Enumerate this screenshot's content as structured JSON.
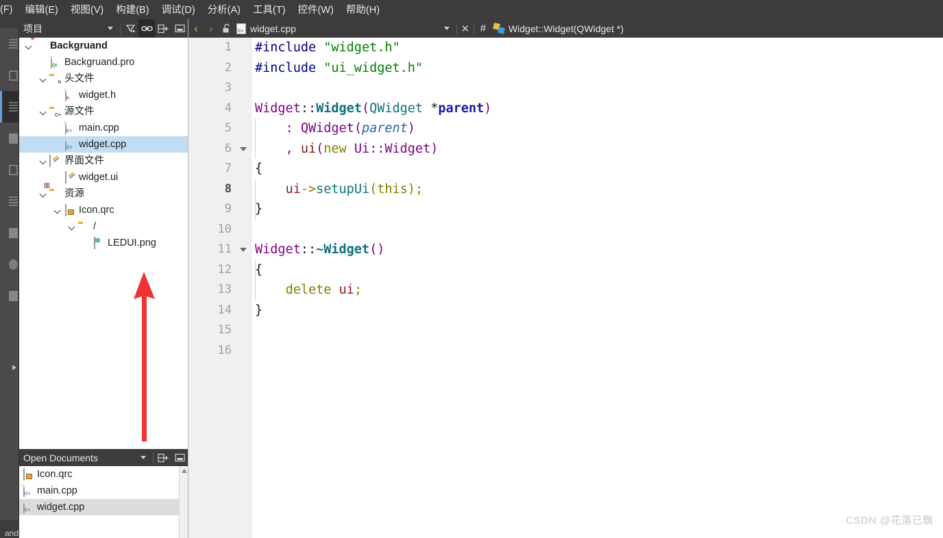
{
  "menubar": {
    "items": [
      {
        "label": "(F)",
        "mnemonic": ""
      },
      {
        "label": "编辑(E)",
        "mnemonic": "E"
      },
      {
        "label": "视图(V)",
        "mnemonic": "V"
      },
      {
        "label": "构建(B)",
        "mnemonic": "B"
      },
      {
        "label": "调试(D)",
        "mnemonic": "D"
      },
      {
        "label": "分析(A)",
        "mnemonic": "A"
      },
      {
        "label": "工具(T)",
        "mnemonic": "T"
      },
      {
        "label": "控件(W)",
        "mnemonic": "W"
      },
      {
        "label": "帮助(H)",
        "mnemonic": "H"
      }
    ]
  },
  "modebar": {
    "bottom_label": "and"
  },
  "dock": {
    "title": "项目",
    "tools": {
      "dropdown": "▾",
      "filter_icon": "filter-icon",
      "link_icon": "link-icon",
      "split_icon": "split-add-icon",
      "collapse_icon": "collapse-icon"
    }
  },
  "tree": {
    "items": [
      {
        "indent": 0,
        "chevron": "expanded",
        "icon": "project-gear-icon",
        "label": "Backgruand",
        "bold": true,
        "selected": false
      },
      {
        "indent": 1,
        "chevron": "none",
        "icon": "qt-pro-file-icon",
        "label": "Backgruand.pro",
        "bold": false,
        "selected": false
      },
      {
        "indent": 1,
        "chevron": "expanded",
        "icon": "folder-headers-icon",
        "label": "头文件",
        "bold": false,
        "selected": false
      },
      {
        "indent": 2,
        "chevron": "none",
        "icon": "header-file-icon",
        "label": "widget.h",
        "bold": false,
        "selected": false
      },
      {
        "indent": 1,
        "chevron": "expanded",
        "icon": "folder-sources-icon",
        "label": "源文件",
        "bold": false,
        "selected": false
      },
      {
        "indent": 2,
        "chevron": "none",
        "icon": "cpp-file-icon",
        "label": "main.cpp",
        "bold": false,
        "selected": false
      },
      {
        "indent": 2,
        "chevron": "none",
        "icon": "cpp-file-icon",
        "label": "widget.cpp",
        "bold": false,
        "selected": true
      },
      {
        "indent": 1,
        "chevron": "expanded",
        "icon": "folder-forms-icon",
        "label": "界面文件",
        "bold": false,
        "selected": false
      },
      {
        "indent": 2,
        "chevron": "none",
        "icon": "ui-file-icon",
        "label": "widget.ui",
        "bold": false,
        "selected": false
      },
      {
        "indent": 1,
        "chevron": "expanded",
        "icon": "folder-resources-icon",
        "label": "资源",
        "bold": false,
        "selected": false
      },
      {
        "indent": 2,
        "chevron": "expanded",
        "icon": "qrc-file-icon",
        "label": "Icon.qrc",
        "bold": false,
        "selected": false
      },
      {
        "indent": 3,
        "chevron": "expanded",
        "icon": "folder-icon",
        "label": "/",
        "bold": false,
        "selected": false
      },
      {
        "indent": 4,
        "chevron": "none",
        "icon": "image-file-icon",
        "label": "LEDUI.png",
        "bold": false,
        "selected": false
      }
    ]
  },
  "annotation": {
    "arrow_color": "#ef3232",
    "arrow_direction": "up"
  },
  "open_documents": {
    "title": "Open Documents",
    "tools": {
      "dropdown": "▾",
      "split_icon": "split-add-icon",
      "collapse_icon": "collapse-icon"
    },
    "items": [
      {
        "icon": "qrc-file-icon",
        "label": "Icon.qrc",
        "selected": false
      },
      {
        "icon": "cpp-file-icon",
        "label": "main.cpp",
        "selected": false
      },
      {
        "icon": "cpp-file-icon",
        "label": "widget.cpp",
        "selected": true
      }
    ]
  },
  "editor_toolbar": {
    "back_arrow": "‹",
    "forward_arrow": "›",
    "lock_icon": "unlock-icon",
    "file_name": "widget.cpp",
    "file_dropdown": "▾",
    "close_label": "✕",
    "hash_label": "#",
    "symbol_icon": "qt-symbol-icon",
    "symbol_name": "Widget::Widget(QWidget *)"
  },
  "code": {
    "current_line": 8,
    "lines": [
      {
        "n": 1,
        "fold": false,
        "tokens": [
          {
            "t": "#include",
            "c": "t-pre"
          },
          {
            "t": " ",
            "c": "t-punc"
          },
          {
            "t": "\"widget.h\"",
            "c": "t-str"
          }
        ]
      },
      {
        "n": 2,
        "fold": false,
        "tokens": [
          {
            "t": "#include",
            "c": "t-pre"
          },
          {
            "t": " ",
            "c": "t-punc"
          },
          {
            "t": "\"ui_widget.h\"",
            "c": "t-str"
          }
        ]
      },
      {
        "n": 3,
        "fold": false,
        "tokens": []
      },
      {
        "n": 4,
        "fold": false,
        "tokens": [
          {
            "t": "Widget",
            "c": "t-type"
          },
          {
            "t": "::",
            "c": "t-punc"
          },
          {
            "t": "Widget",
            "c": "t-func"
          },
          {
            "t": "(",
            "c": "t-type"
          },
          {
            "t": "QWidget",
            "c": "t-typeB"
          },
          {
            "t": " ",
            "c": "t-punc"
          },
          {
            "t": "*",
            "c": "t-punc"
          },
          {
            "t": "parent",
            "c": "t-param"
          },
          {
            "t": ")",
            "c": "t-type"
          }
        ]
      },
      {
        "n": 5,
        "fold": false,
        "tokens": [
          {
            "t": "    ",
            "c": "t-punc"
          },
          {
            "t": ": ",
            "c": "t-type"
          },
          {
            "t": "QWidget",
            "c": "t-type"
          },
          {
            "t": "(",
            "c": "t-type"
          },
          {
            "t": "parent",
            "c": "t-paramI"
          },
          {
            "t": ")",
            "c": "t-type"
          }
        ]
      },
      {
        "n": 6,
        "fold": true,
        "tokens": [
          {
            "t": "    ",
            "c": "t-punc"
          },
          {
            "t": ", ",
            "c": "t-type"
          },
          {
            "t": "ui",
            "c": "t-field"
          },
          {
            "t": "(",
            "c": "t-type"
          },
          {
            "t": "new",
            "c": "t-kw"
          },
          {
            "t": " ",
            "c": "t-punc"
          },
          {
            "t": "Ui::Widget",
            "c": "t-type"
          },
          {
            "t": ")",
            "c": "t-type"
          }
        ]
      },
      {
        "n": 7,
        "fold": false,
        "tokens": [
          {
            "t": "{",
            "c": "t-brace"
          }
        ]
      },
      {
        "n": 8,
        "fold": false,
        "tokens": [
          {
            "t": "    ",
            "c": "t-punc"
          },
          {
            "t": "ui",
            "c": "t-field"
          },
          {
            "t": "->",
            "c": "t-op"
          },
          {
            "t": "setupUi",
            "c": "t-typeB"
          },
          {
            "t": "(",
            "c": "t-op"
          },
          {
            "t": "this",
            "c": "t-kw"
          },
          {
            "t": ")",
            "c": "t-op"
          },
          {
            "t": ";",
            "c": "t-op"
          }
        ]
      },
      {
        "n": 9,
        "fold": false,
        "tokens": [
          {
            "t": "}",
            "c": "t-brace"
          }
        ]
      },
      {
        "n": 10,
        "fold": false,
        "tokens": []
      },
      {
        "n": 11,
        "fold": true,
        "tokens": [
          {
            "t": "Widget",
            "c": "t-type"
          },
          {
            "t": "::",
            "c": "t-punc"
          },
          {
            "t": "~Widget",
            "c": "t-func"
          },
          {
            "t": "()",
            "c": "t-type"
          }
        ]
      },
      {
        "n": 12,
        "fold": false,
        "tokens": [
          {
            "t": "{",
            "c": "t-brace"
          }
        ]
      },
      {
        "n": 13,
        "fold": false,
        "tokens": [
          {
            "t": "    ",
            "c": "t-punc"
          },
          {
            "t": "delete",
            "c": "t-kw"
          },
          {
            "t": " ",
            "c": "t-punc"
          },
          {
            "t": "ui",
            "c": "t-field"
          },
          {
            "t": ";",
            "c": "t-op"
          }
        ]
      },
      {
        "n": 14,
        "fold": false,
        "tokens": [
          {
            "t": "}",
            "c": "t-brace"
          }
        ]
      },
      {
        "n": 15,
        "fold": false,
        "tokens": []
      },
      {
        "n": 16,
        "fold": false,
        "tokens": []
      }
    ]
  },
  "watermark": {
    "text": "CSDN @花落已飘"
  },
  "colors": {
    "chrome": "#3c3c3c",
    "modebar": "#4a4a4a",
    "selection": "#c2ddf2",
    "od_selection": "#dcdcdc",
    "gutter": "#f0f0f0",
    "annotation_red": "#ef3232"
  }
}
